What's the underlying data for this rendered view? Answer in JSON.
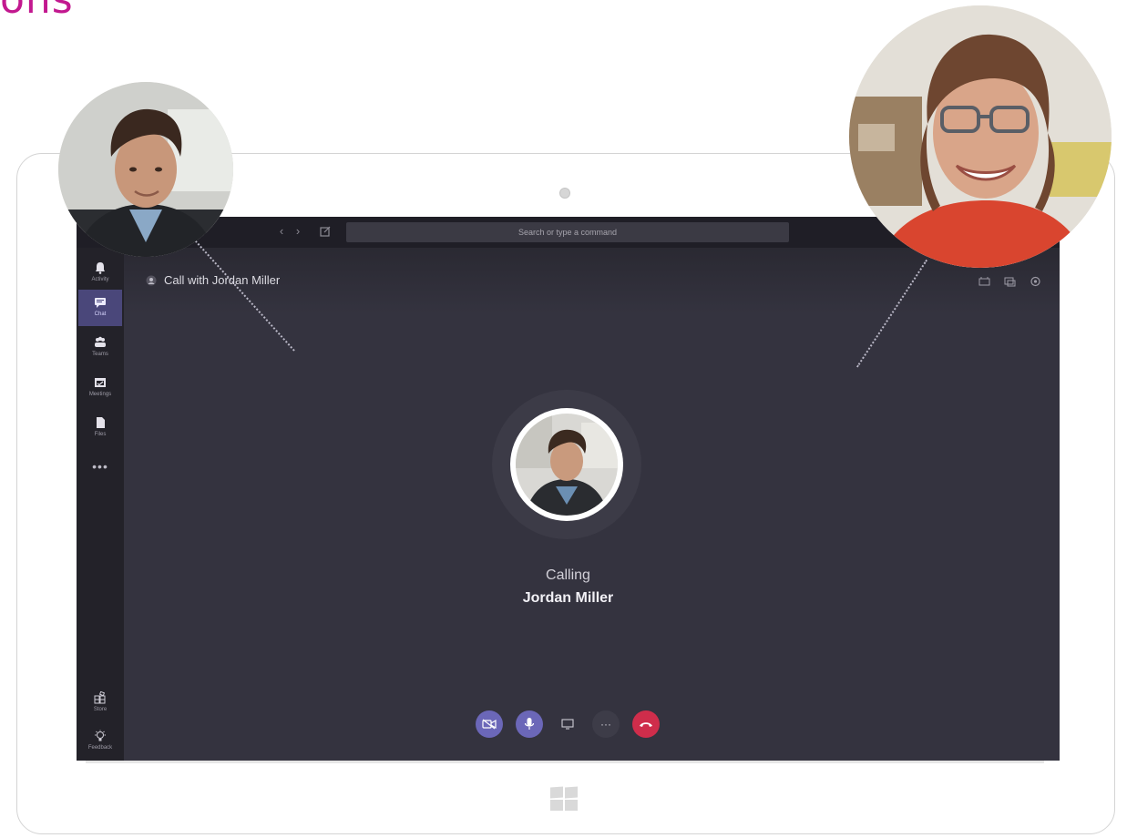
{
  "brand_fragment": "ons",
  "window": {
    "search_placeholder": "Search or type a command"
  },
  "rail": {
    "items": [
      {
        "label": "Activity",
        "icon": "bell-icon"
      },
      {
        "label": "Chat",
        "icon": "chat-icon",
        "active": true
      },
      {
        "label": "Teams",
        "icon": "teams-icon"
      },
      {
        "label": "Meetings",
        "icon": "calendar-icon"
      },
      {
        "label": "Files",
        "icon": "file-icon"
      }
    ],
    "more": "•••",
    "bottom": [
      {
        "label": "Store",
        "icon": "store-icon"
      },
      {
        "label": "Feedback",
        "icon": "lightbulb-icon"
      }
    ]
  },
  "call": {
    "title": "Call with Jordan Miller",
    "status": "Calling",
    "callee": "Jordan Miller"
  },
  "controls": {
    "more": "···"
  },
  "colors": {
    "screen_bg": "#34333f",
    "accent": "#6b67b8",
    "hangup": "#cf2d4b",
    "brand": "#c2188f"
  }
}
